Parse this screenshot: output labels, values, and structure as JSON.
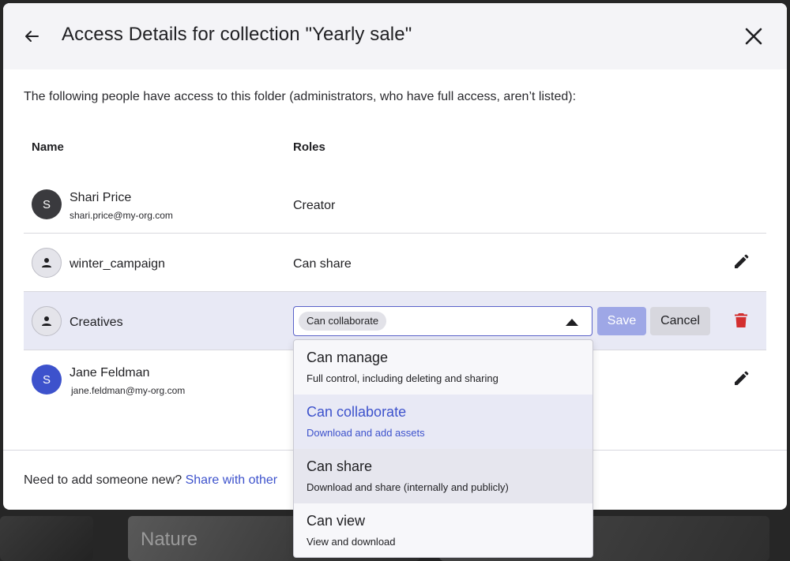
{
  "background": {
    "card_label": "Nature"
  },
  "dialog": {
    "title": "Access Details for collection \"Yearly sale\"",
    "intro": "The following people have access to this folder (administrators, who have full access, aren’t listed):",
    "columns": {
      "name": "Name",
      "roles": "Roles"
    },
    "rows": [
      {
        "initial": "S",
        "name": "Shari Price",
        "email": "shari.price@my-org.com",
        "role": "Creator"
      },
      {
        "name": "winter_campaign",
        "role": "Can share"
      },
      {
        "name": "Creatives",
        "role": "Can collaborate"
      },
      {
        "initial": "S",
        "name": "Jane Feldman",
        "email": "jane.feldman@my-org.com"
      }
    ],
    "actions": {
      "save": "Save",
      "cancel": "Cancel"
    },
    "footer": {
      "prompt": "Need to add someone new?",
      "link": "Share with other"
    }
  },
  "dropdown": {
    "options": [
      {
        "title": "Can manage",
        "desc": "Full control, including deleting and sharing"
      },
      {
        "title": "Can collaborate",
        "desc": "Download and add assets",
        "selected": true
      },
      {
        "title": "Can share",
        "desc": "Download and share (internally and publicly)",
        "hovered": true
      },
      {
        "title": "Can view",
        "desc": "View and download"
      }
    ]
  },
  "colors": {
    "accent": "#3d52cc",
    "header_bg": "#f4f4f7",
    "selected_row_bg": "#e8e9f5",
    "save_disabled": "#9ea7e6",
    "delete": "#d32f2f"
  }
}
